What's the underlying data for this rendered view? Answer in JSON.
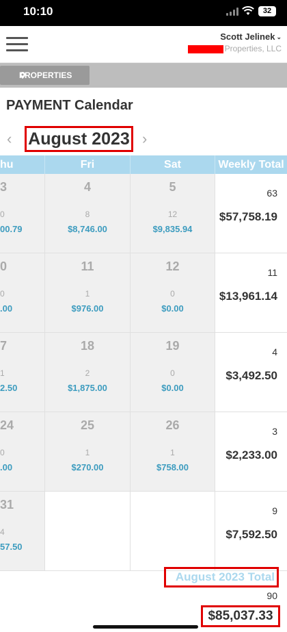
{
  "status_bar": {
    "time": "10:10",
    "battery": "32"
  },
  "header": {
    "user_name": "Scott Jelinek",
    "company_suffix": "Properties, LLC"
  },
  "properties_button": {
    "label": "PROPERTIES"
  },
  "page_title": "PAYMENT Calendar",
  "month_nav": {
    "label": "August 2023",
    "prev": "‹",
    "next": "›"
  },
  "columns": [
    "hu",
    "Fri",
    "Sat",
    "Weekly Total"
  ],
  "weeks": [
    {
      "days": [
        {
          "day": "3",
          "count": "0",
          "amount": "00.79"
        },
        {
          "day": "4",
          "count": "8",
          "amount": "$8,746.00"
        },
        {
          "day": "5",
          "count": "12",
          "amount": "$9,835.94"
        }
      ],
      "weekly_count": "63",
      "weekly_amount": "$57,758.19"
    },
    {
      "days": [
        {
          "day": "0",
          "count": "0",
          "amount": ".00"
        },
        {
          "day": "11",
          "count": "1",
          "amount": "$976.00"
        },
        {
          "day": "12",
          "count": "0",
          "amount": "$0.00"
        }
      ],
      "weekly_count": "11",
      "weekly_amount": "$13,961.14"
    },
    {
      "days": [
        {
          "day": "7",
          "count": "1",
          "amount": "2.50"
        },
        {
          "day": "18",
          "count": "2",
          "amount": "$1,875.00"
        },
        {
          "day": "19",
          "count": "0",
          "amount": "$0.00"
        }
      ],
      "weekly_count": "4",
      "weekly_amount": "$3,492.50"
    },
    {
      "days": [
        {
          "day": "24",
          "count": "0",
          "amount": ".00"
        },
        {
          "day": "25",
          "count": "1",
          "amount": "$270.00"
        },
        {
          "day": "26",
          "count": "1",
          "amount": "$758.00"
        }
      ],
      "weekly_count": "3",
      "weekly_amount": "$2,233.00"
    },
    {
      "days": [
        {
          "day": "31",
          "count": "4",
          "amount": "57.50"
        }
      ],
      "weekly_count": "9",
      "weekly_amount": "$7,592.50"
    }
  ],
  "month_total": {
    "label": "August 2023 Total",
    "count": "90",
    "amount": "$85,037.33"
  },
  "colors": {
    "header_blue": "#abd8ee",
    "amount_blue": "#3d9cbf",
    "highlight_red": "#e00000",
    "redaction_red": "#ff0000"
  }
}
